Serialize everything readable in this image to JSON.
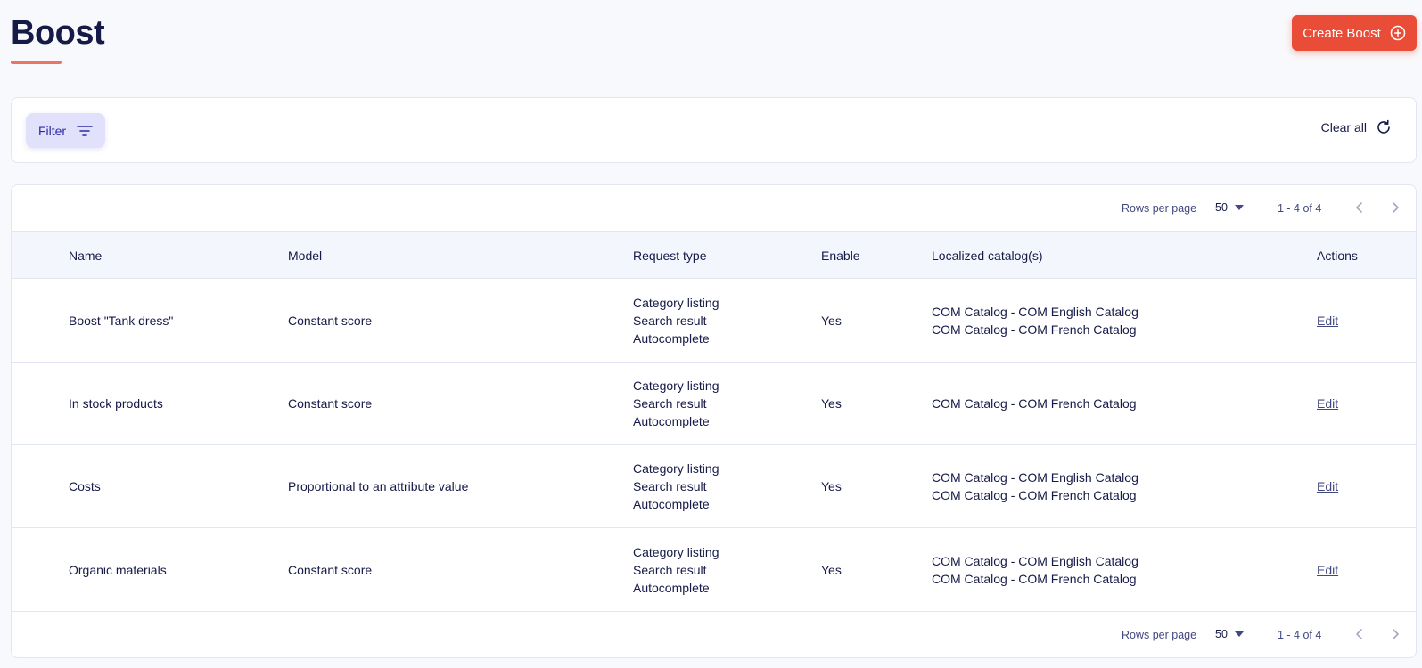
{
  "page": {
    "title": "Boost"
  },
  "toolbar": {
    "create_label": "Create Boost"
  },
  "filters": {
    "filter_label": "Filter",
    "clear_label": "Clear all"
  },
  "pagination": {
    "rows_per_page_label": "Rows per page",
    "rows_per_page_value": "50",
    "range_text": "1 - 4 of 4"
  },
  "table": {
    "columns": [
      "Name",
      "Model",
      "Request type",
      "Enable",
      "Localized catalog(s)",
      "Actions"
    ],
    "rows": [
      {
        "name": "Boost \"Tank dress\"",
        "model": "Constant score",
        "request_types": [
          "Category listing",
          "Search result",
          "Autocomplete"
        ],
        "enable": "Yes",
        "catalogs": [
          "COM Catalog - COM English Catalog",
          "COM Catalog - COM French Catalog"
        ],
        "action": "Edit"
      },
      {
        "name": "In stock products",
        "model": "Constant score",
        "request_types": [
          "Category listing",
          "Search result",
          "Autocomplete"
        ],
        "enable": "Yes",
        "catalogs": [
          "COM Catalog - COM French Catalog"
        ],
        "action": "Edit"
      },
      {
        "name": "Costs",
        "model": "Proportional to an attribute value",
        "request_types": [
          "Category listing",
          "Search result",
          "Autocomplete"
        ],
        "enable": "Yes",
        "catalogs": [
          "COM Catalog - COM English Catalog",
          "COM Catalog - COM French Catalog"
        ],
        "action": "Edit"
      },
      {
        "name": "Organic materials",
        "model": "Constant score",
        "request_types": [
          "Category listing",
          "Search result",
          "Autocomplete"
        ],
        "enable": "Yes",
        "catalogs": [
          "COM Catalog - COM English Catalog",
          "COM Catalog - COM French Catalog"
        ],
        "action": "Edit"
      }
    ]
  },
  "colors": {
    "accent": "#e94c37",
    "title": "#151a47",
    "filter_bg": "#e2e1fb",
    "header_bg": "#f4f6fd"
  },
  "icons": {
    "create": "plus-circle-icon",
    "filter": "filter-lines-icon",
    "clear": "refresh-icon",
    "rows_dropdown": "caret-down-icon",
    "prev": "chevron-left-icon",
    "next": "chevron-right-icon"
  }
}
